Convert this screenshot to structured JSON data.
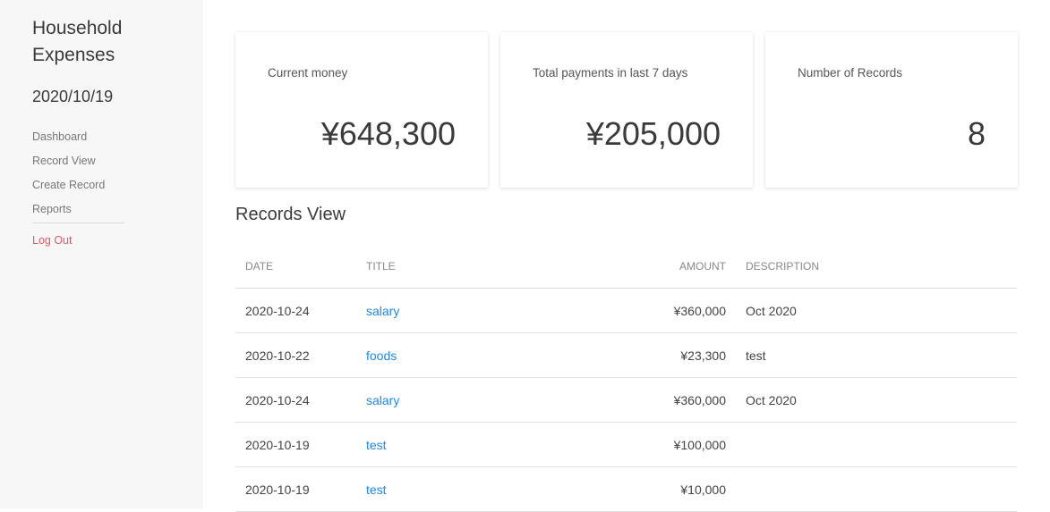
{
  "sidebar": {
    "app_title": "Household Expenses",
    "date": "2020/10/19",
    "nav": [
      "Dashboard",
      "Record View",
      "Create Record",
      "Reports"
    ],
    "logout": "Log Out"
  },
  "cards": [
    {
      "label": "Current money",
      "value": "¥648,300"
    },
    {
      "label": "Total payments in last 7 days",
      "value": "¥205,000"
    },
    {
      "label": "Number of Records",
      "value": "8"
    }
  ],
  "records": {
    "title": "Records View",
    "columns": {
      "date": "DATE",
      "title": "TITLE",
      "amount": "AMOUNT",
      "description": "DESCRIPTION"
    },
    "rows": [
      {
        "date": "2020-10-24",
        "title": "salary",
        "amount": "¥360,000",
        "description": "Oct 2020"
      },
      {
        "date": "2020-10-22",
        "title": "foods",
        "amount": "¥23,300",
        "description": "test"
      },
      {
        "date": "2020-10-24",
        "title": "salary",
        "amount": "¥360,000",
        "description": "Oct 2020"
      },
      {
        "date": "2020-10-19",
        "title": "test",
        "amount": "¥100,000",
        "description": ""
      },
      {
        "date": "2020-10-19",
        "title": "test",
        "amount": "¥10,000",
        "description": ""
      }
    ]
  },
  "colors": {
    "link": "#1e87f0",
    "logout": "#e05a64",
    "sidebar_bg": "#f7f7f7"
  }
}
